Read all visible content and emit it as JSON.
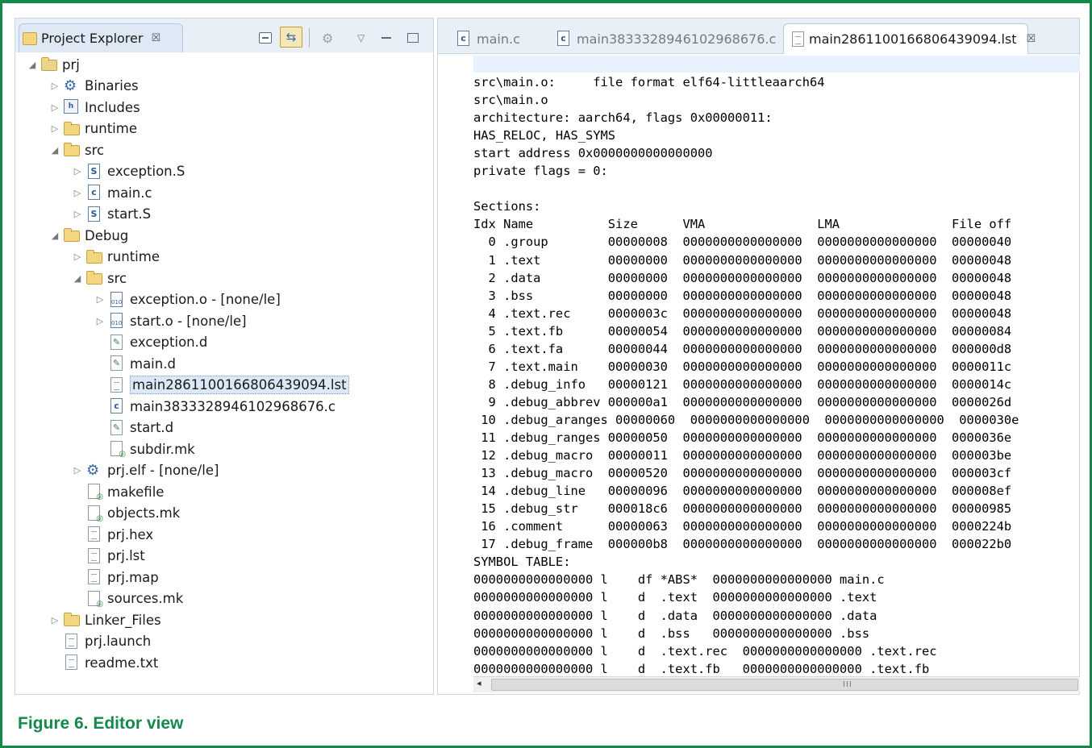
{
  "explorer": {
    "tab_label": "Project Explorer",
    "close_glyph": "☒",
    "tree": [
      {
        "label": "prj",
        "icon": "project-folder-icon",
        "depth": 0,
        "arrow": "◢",
        "type": "project"
      },
      {
        "label": "Binaries",
        "icon": "binaries-icon",
        "depth": 1,
        "arrow": "▷",
        "type": "gear"
      },
      {
        "label": "Includes",
        "icon": "includes-icon",
        "depth": 1,
        "arrow": "▷",
        "type": "includes"
      },
      {
        "label": "runtime",
        "icon": "source-folder-icon",
        "depth": 1,
        "arrow": "▷",
        "type": "folder"
      },
      {
        "label": "src",
        "icon": "source-folder-icon",
        "depth": 1,
        "arrow": "◢",
        "type": "folder"
      },
      {
        "label": "exception.S",
        "icon": "asm-file-icon",
        "depth": 2,
        "arrow": "▷",
        "type": "letter",
        "letter": "S"
      },
      {
        "label": "main.c",
        "icon": "c-file-icon",
        "depth": 2,
        "arrow": "▷",
        "type": "letter",
        "letter": "c"
      },
      {
        "label": "start.S",
        "icon": "asm-file-icon",
        "depth": 2,
        "arrow": "▷",
        "type": "letter",
        "letter": "S"
      },
      {
        "label": "Debug",
        "icon": "folder-icon",
        "depth": 1,
        "arrow": "◢",
        "type": "folder"
      },
      {
        "label": "runtime",
        "icon": "folder-icon",
        "depth": 2,
        "arrow": "▷",
        "type": "folder"
      },
      {
        "label": "src",
        "icon": "folder-icon",
        "depth": 2,
        "arrow": "◢",
        "type": "folder"
      },
      {
        "label": "exception.o - [none/le]",
        "icon": "object-file-icon",
        "depth": 3,
        "arrow": "▷",
        "type": "bin"
      },
      {
        "label": "start.o - [none/le]",
        "icon": "object-file-icon",
        "depth": 3,
        "arrow": "▷",
        "type": "bin"
      },
      {
        "label": "exception.d",
        "icon": "dependency-file-icon",
        "depth": 3,
        "arrow": "",
        "type": "dfile"
      },
      {
        "label": "main.d",
        "icon": "dependency-file-icon",
        "depth": 3,
        "arrow": "",
        "type": "dfile"
      },
      {
        "label": "main2861100166806439094.lst",
        "icon": "text-file-icon",
        "depth": 3,
        "arrow": "",
        "type": "file",
        "selected": true
      },
      {
        "label": "main3833328946102968676.c",
        "icon": "c-file-icon",
        "depth": 3,
        "arrow": "",
        "type": "letter",
        "letter": "c"
      },
      {
        "label": "start.d",
        "icon": "dependency-file-icon",
        "depth": 3,
        "arrow": "",
        "type": "dfile"
      },
      {
        "label": "subdir.mk",
        "icon": "makefile-icon",
        "depth": 3,
        "arrow": "",
        "type": "mk"
      },
      {
        "label": "prj.elf - [none/le]",
        "icon": "executable-icon",
        "depth": 2,
        "arrow": "▷",
        "type": "gear"
      },
      {
        "label": "makefile",
        "icon": "makefile-icon",
        "depth": 2,
        "arrow": "",
        "type": "mk"
      },
      {
        "label": "objects.mk",
        "icon": "makefile-icon",
        "depth": 2,
        "arrow": "",
        "type": "mk"
      },
      {
        "label": "prj.hex",
        "icon": "text-file-icon",
        "depth": 2,
        "arrow": "",
        "type": "file"
      },
      {
        "label": "prj.lst",
        "icon": "text-file-icon",
        "depth": 2,
        "arrow": "",
        "type": "file"
      },
      {
        "label": "prj.map",
        "icon": "text-file-icon",
        "depth": 2,
        "arrow": "",
        "type": "file"
      },
      {
        "label": "sources.mk",
        "icon": "makefile-icon",
        "depth": 2,
        "arrow": "",
        "type": "mk"
      },
      {
        "label": "Linker_Files",
        "icon": "folder-icon",
        "depth": 1,
        "arrow": "▷",
        "type": "folder"
      },
      {
        "label": "prj.launch",
        "icon": "text-file-icon",
        "depth": 1,
        "arrow": "",
        "type": "file"
      },
      {
        "label": "readme.txt",
        "icon": "text-file-icon",
        "depth": 1,
        "arrow": "",
        "type": "file"
      }
    ]
  },
  "editor": {
    "tabs": [
      {
        "label": "main.c",
        "icon": "c-file-icon",
        "active": false
      },
      {
        "label": "main3833328946102968676.c",
        "icon": "c-file-icon",
        "active": false
      },
      {
        "label": "main2861100166806439094.lst",
        "icon": "text-file-icon",
        "active": true
      }
    ],
    "close_glyph": "☒",
    "lines": [
      "src\\main.o:     file format elf64-littleaarch64",
      "src\\main.o",
      "architecture: aarch64, flags 0x00000011:",
      "HAS_RELOC, HAS_SYMS",
      "start address 0x0000000000000000",
      "private flags = 0:",
      "",
      "Sections:",
      "Idx Name          Size      VMA               LMA               File off",
      "  0 .group        00000008  0000000000000000  0000000000000000  00000040",
      "  1 .text         00000000  0000000000000000  0000000000000000  00000048",
      "  2 .data         00000000  0000000000000000  0000000000000000  00000048",
      "  3 .bss          00000000  0000000000000000  0000000000000000  00000048",
      "  4 .text.rec     0000003c  0000000000000000  0000000000000000  00000048",
      "  5 .text.fb      00000054  0000000000000000  0000000000000000  00000084",
      "  6 .text.fa      00000044  0000000000000000  0000000000000000  000000d8",
      "  7 .text.main    00000030  0000000000000000  0000000000000000  0000011c",
      "  8 .debug_info   00000121  0000000000000000  0000000000000000  0000014c",
      "  9 .debug_abbrev 000000a1  0000000000000000  0000000000000000  0000026d",
      " 10 .debug_aranges 00000060  0000000000000000  0000000000000000  0000030e",
      " 11 .debug_ranges 00000050  0000000000000000  0000000000000000  0000036e",
      " 12 .debug_macro  00000011  0000000000000000  0000000000000000  000003be",
      " 13 .debug_macro  00000520  0000000000000000  0000000000000000  000003cf",
      " 14 .debug_line   00000096  0000000000000000  0000000000000000  000008ef",
      " 15 .debug_str    000018c6  0000000000000000  0000000000000000  00000985",
      " 16 .comment      00000063  0000000000000000  0000000000000000  0000224b",
      " 17 .debug_frame  000000b8  0000000000000000  0000000000000000  000022b0",
      "SYMBOL TABLE:",
      "0000000000000000 l    df *ABS*  0000000000000000 main.c",
      "0000000000000000 l    d  .text  0000000000000000 .text",
      "0000000000000000 l    d  .data  0000000000000000 .data",
      "0000000000000000 l    d  .bss   0000000000000000 .bss",
      "0000000000000000 l    d  .text.rec  0000000000000000 .text.rec",
      "0000000000000000 l    d  .text.fb   0000000000000000 .text.fb"
    ],
    "scroll_grip": "III"
  },
  "caption": "Figure 6.  Editor view"
}
